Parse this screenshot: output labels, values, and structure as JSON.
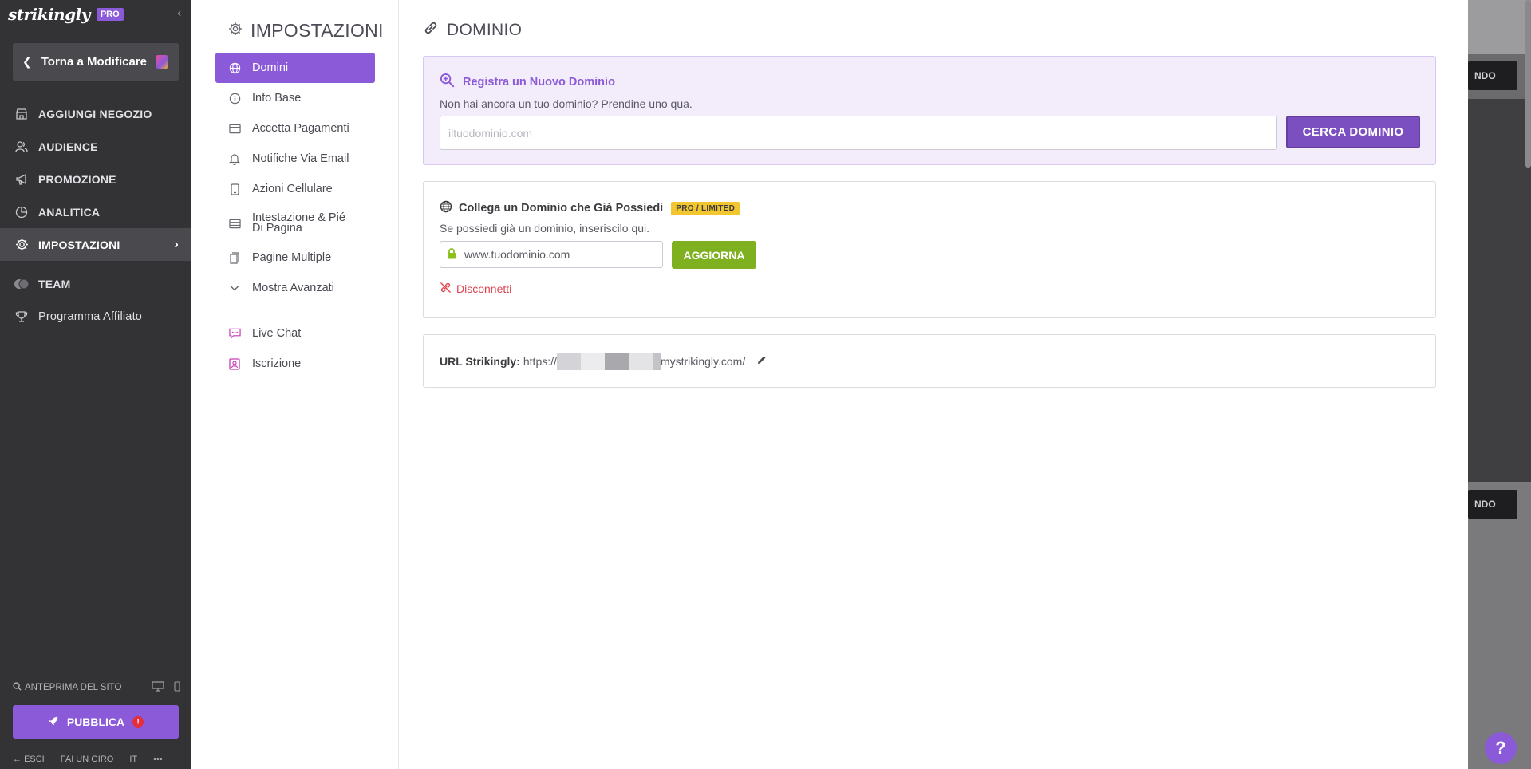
{
  "sidebar": {
    "brand": "strikingly",
    "pro_badge": "PRO",
    "back_label": "Torna a Modificare",
    "items": [
      {
        "label": "AGGIUNGI NEGOZIO",
        "icon": "store-icon"
      },
      {
        "label": "AUDIENCE",
        "icon": "users-icon"
      },
      {
        "label": "PROMOZIONE",
        "icon": "megaphone-icon"
      },
      {
        "label": "ANALITICA",
        "icon": "pie-chart-icon"
      },
      {
        "label": "IMPOSTAZIONI",
        "icon": "gear-icon"
      },
      {
        "label": "TEAM",
        "icon": "team-icon"
      },
      {
        "label": "Programma Affiliato",
        "icon": "trophy-icon"
      }
    ],
    "preview_label": "ANTEPRIMA DEL SITO",
    "publish_label": "PUBBLICA",
    "footer": {
      "exit": "ESCI",
      "tour": "FAI UN GIRO",
      "lang": "IT",
      "more": "•••"
    }
  },
  "settings": {
    "title": "IMPOSTAZIONI",
    "menu": [
      {
        "label": "Domini",
        "icon": "globe-icon"
      },
      {
        "label": "Info Base",
        "icon": "info-icon"
      },
      {
        "label": "Accetta Pagamenti",
        "icon": "card-icon"
      },
      {
        "label": "Notifiche Via Email",
        "icon": "bell-icon"
      },
      {
        "label": "Azioni Cellulare",
        "icon": "mobile-icon"
      },
      {
        "label": "Intestazione & Pié Di Pagina",
        "icon": "layout-icon"
      },
      {
        "label": "Pagine Multiple",
        "icon": "pages-icon"
      },
      {
        "label": "Mostra Avanzati",
        "icon": "chevron-down-icon"
      },
      {
        "label": "Live Chat",
        "icon": "chat-icon"
      },
      {
        "label": "Iscrizione",
        "icon": "contact-icon"
      }
    ]
  },
  "main": {
    "title": "DOMINIO",
    "register": {
      "heading": "Registra un Nuovo Dominio",
      "desc": "Non hai ancora un tuo dominio? Prendine uno qua.",
      "placeholder": "iltuodominio.com",
      "button": "CERCA DOMINIO"
    },
    "connect": {
      "heading": "Collega un Dominio che Già Possiedi",
      "badge": "PRO / LIMITED",
      "desc": "Se possiedi già un dominio, inseriscilo qui.",
      "value": "www.tuodominio.com",
      "button": "AGGIORNA",
      "disconnect": "Disconnetti"
    },
    "url": {
      "label": "URL Strikingly:",
      "prefix": "https://",
      "suffix": "mystrikingly.com/"
    }
  },
  "backdrop": {
    "ghost_label": "NDO"
  },
  "help_label": "?",
  "colors": {
    "accent": "#8b5ad8",
    "sidebar_bg": "#333336",
    "success": "#7fb020",
    "danger": "#e0454e",
    "badge": "#f2c62f"
  }
}
